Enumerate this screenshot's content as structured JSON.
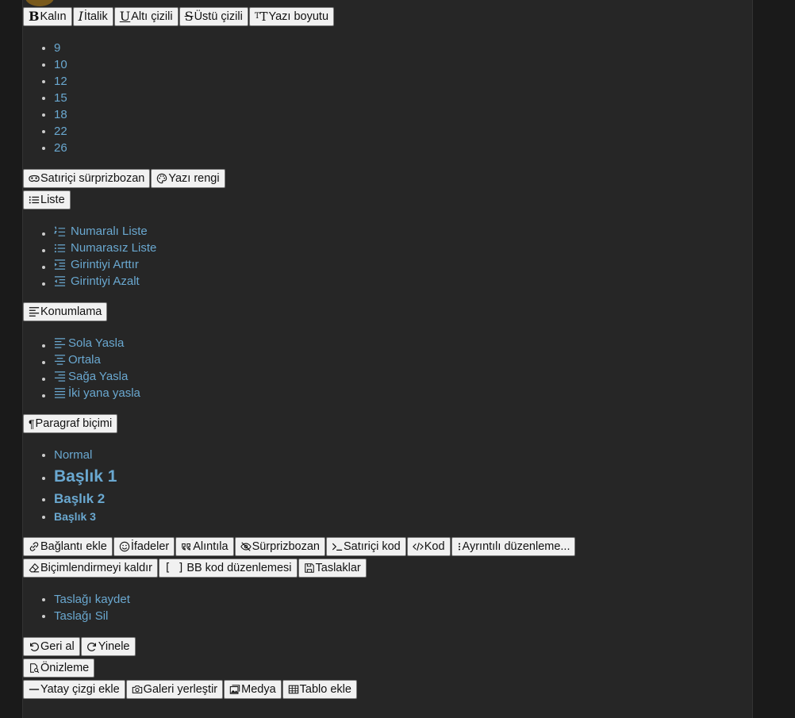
{
  "toolbar1": {
    "bold": "Kalın",
    "italic": "İtalik",
    "underline": "Altı çizili",
    "strike": "Üstü çizili",
    "font_size": "Yazı boyutu"
  },
  "font_sizes": [
    "9",
    "10",
    "12",
    "15",
    "18",
    "22",
    "26"
  ],
  "toolbar2": {
    "inline_spoiler": "Satıriçi sürprizbozan",
    "text_color": "Yazı rengi"
  },
  "list_button": "Liste",
  "list_menu": [
    "Numaralı Liste",
    "Numarasız Liste",
    "Girintiyi Arttır",
    "Girintiyi Azalt"
  ],
  "align_button": "Konumlama",
  "align_menu": [
    "Sola Yasla",
    "Ortala",
    "Sağa Yasla",
    "İki yana yasla"
  ],
  "para_button": "Paragraf biçimi",
  "para_menu": [
    "Normal",
    "Başlık 1",
    "Başlık 2",
    "Başlık 3"
  ],
  "toolbar3": {
    "link": "Bağlantı ekle",
    "smilies": "İfadeler",
    "quote": "Alıntıla",
    "spoiler": "Sürprizbozan",
    "inline_code": "Satıriçi kod",
    "code": "Kod",
    "more": "Ayrıntılı düzenleme..."
  },
  "toolbar4": {
    "remove_format": "Biçimlendirmeyi kaldır",
    "bb_code": "BB kod düzenlemesi",
    "drafts": "Taslaklar"
  },
  "drafts_menu": [
    "Taslağı kaydet",
    "Taslağı Sil"
  ],
  "toolbar5": {
    "undo": "Geri al",
    "redo": "Yinele"
  },
  "preview": "Önizleme",
  "toolbar6": {
    "hr": "Yatay çizgi ekle",
    "gallery": "Galeri yerleştir",
    "media": "Medya",
    "table": "Tablo ekle"
  }
}
